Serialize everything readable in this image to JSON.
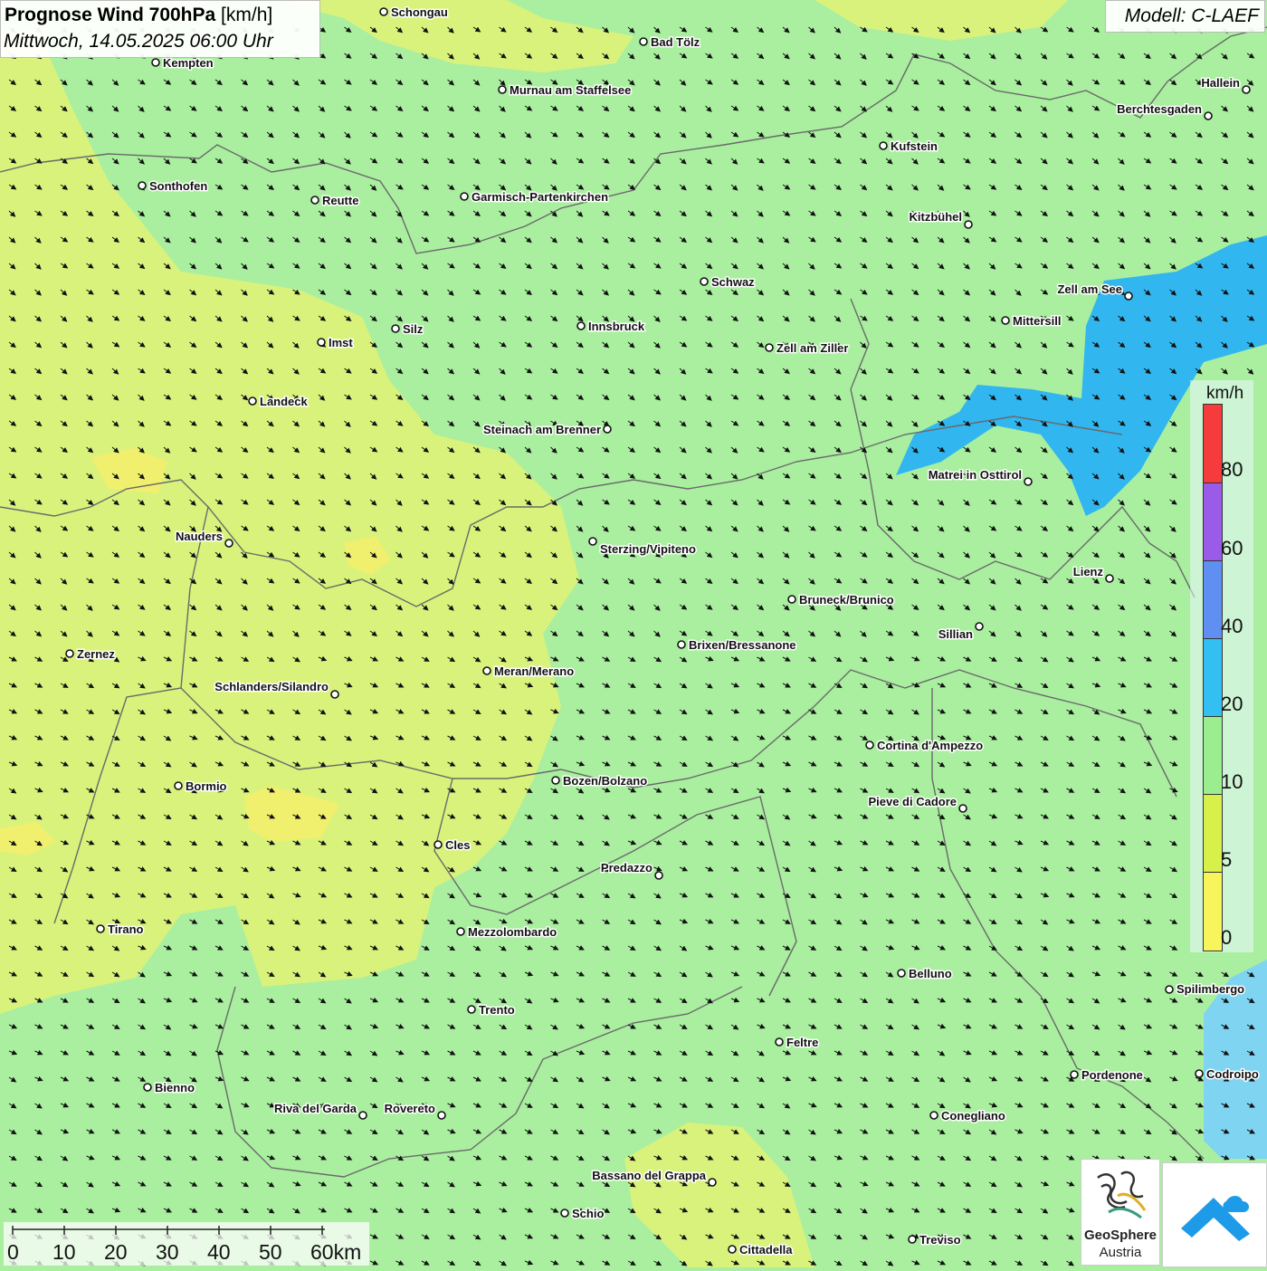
{
  "header": {
    "title_main": "Prognose Wind 700hPa",
    "title_unit": "[km/h]",
    "subtitle": "Mittwoch, 14.05.2025 06:00 Uhr",
    "model": "Modell: C-LAEF"
  },
  "legend": {
    "unit": "km/h",
    "classes": [
      {
        "label": "80",
        "color": "#f53b3b"
      },
      {
        "label": "60",
        "color": "#9a5be8"
      },
      {
        "label": "40",
        "color": "#5f8ff0"
      },
      {
        "label": "20",
        "color": "#33bff2"
      },
      {
        "label": "10",
        "color": "#9bee8e"
      },
      {
        "label": "5",
        "color": "#d8f04a"
      },
      {
        "label": "0",
        "color": "#f7f45c"
      }
    ]
  },
  "scale_bar": {
    "ticks": [
      "0",
      "10",
      "20",
      "30",
      "40",
      "50",
      "60km"
    ]
  },
  "cities": [
    {
      "name": "Schongau"
    },
    {
      "name": "Bad Tölz"
    },
    {
      "name": "Kempten"
    },
    {
      "name": "Murnau am Staffelsee"
    },
    {
      "name": "Hallein"
    },
    {
      "name": "Berchtesgaden"
    },
    {
      "name": "Kufstein"
    },
    {
      "name": "Sonthofen"
    },
    {
      "name": "Reutte"
    },
    {
      "name": "Garmisch-Partenkirchen"
    },
    {
      "name": "Kitzbühel"
    },
    {
      "name": "Schwaz"
    },
    {
      "name": "Zell am See"
    },
    {
      "name": "Mittersill"
    },
    {
      "name": "Innsbruck"
    },
    {
      "name": "Silz"
    },
    {
      "name": "Imst"
    },
    {
      "name": "Zell am Ziller"
    },
    {
      "name": "Landeck"
    },
    {
      "name": "Steinach am Brenner"
    },
    {
      "name": "Matrei in Osttirol"
    },
    {
      "name": "Nauders"
    },
    {
      "name": "Sterzing/Vipiteno"
    },
    {
      "name": "Lienz"
    },
    {
      "name": "Bruneck/Brunico"
    },
    {
      "name": "Sillian"
    },
    {
      "name": "Brixen/Bressanone"
    },
    {
      "name": "Zernez"
    },
    {
      "name": "Meran/Merano"
    },
    {
      "name": "Schlanders/Silandro"
    },
    {
      "name": "Cortina d'Ampezzo"
    },
    {
      "name": "Bozen/Bolzano"
    },
    {
      "name": "Bormio"
    },
    {
      "name": "Pieve di Cadore"
    },
    {
      "name": "Cles"
    },
    {
      "name": "Predazzo"
    },
    {
      "name": "Tirano"
    },
    {
      "name": "Mezzolombardo"
    },
    {
      "name": "Belluno"
    },
    {
      "name": "Spilimbergo"
    },
    {
      "name": "Trento"
    },
    {
      "name": "Feltre"
    },
    {
      "name": "Bienno"
    },
    {
      "name": "Pordenone"
    },
    {
      "name": "Codroipo"
    },
    {
      "name": "Riva del Garda"
    },
    {
      "name": "Rovereto"
    },
    {
      "name": "Conegliano"
    },
    {
      "name": "Bassano del Grappa"
    },
    {
      "name": "Schio"
    },
    {
      "name": "Treviso"
    },
    {
      "name": "Cittadella"
    }
  ],
  "logos": {
    "geosphere_name": "GeoSphere",
    "geosphere_sub": "Austria"
  }
}
